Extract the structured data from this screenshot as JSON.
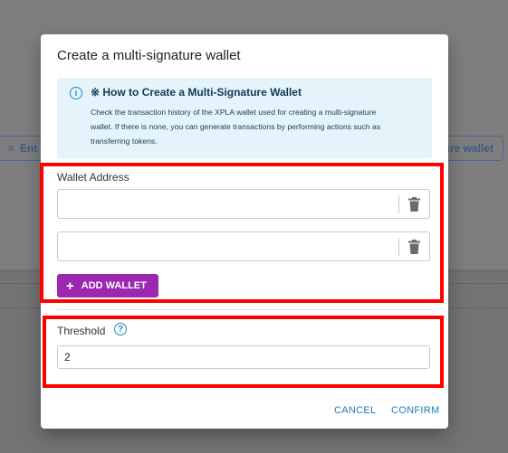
{
  "background": {
    "left_button_label": "Ent",
    "right_button_label": "ure wallet"
  },
  "dialog": {
    "title": "Create a multi-signature wallet",
    "info": {
      "title": "※ How to Create a Multi-Signature Wallet",
      "line1": "Check the transaction history of the XPLA wallet used for creating a multi-signature",
      "line2": "wallet. If there is none, you can generate transactions by performing actions such as",
      "line3": "transferring tokens."
    },
    "wallet_address_label": "Wallet Address",
    "wallet_inputs": [
      {
        "value": ""
      },
      {
        "value": ""
      }
    ],
    "add_wallet_label": "ADD WALLET",
    "threshold_label": "Threshold",
    "threshold_value": "2",
    "cancel_label": "CANCEL",
    "confirm_label": "CONFIRM"
  },
  "colors": {
    "accent": "#9c27b0",
    "link": "#1f7ab8",
    "info_bg": "#e5f4fb",
    "highlight": "#ff0000"
  }
}
